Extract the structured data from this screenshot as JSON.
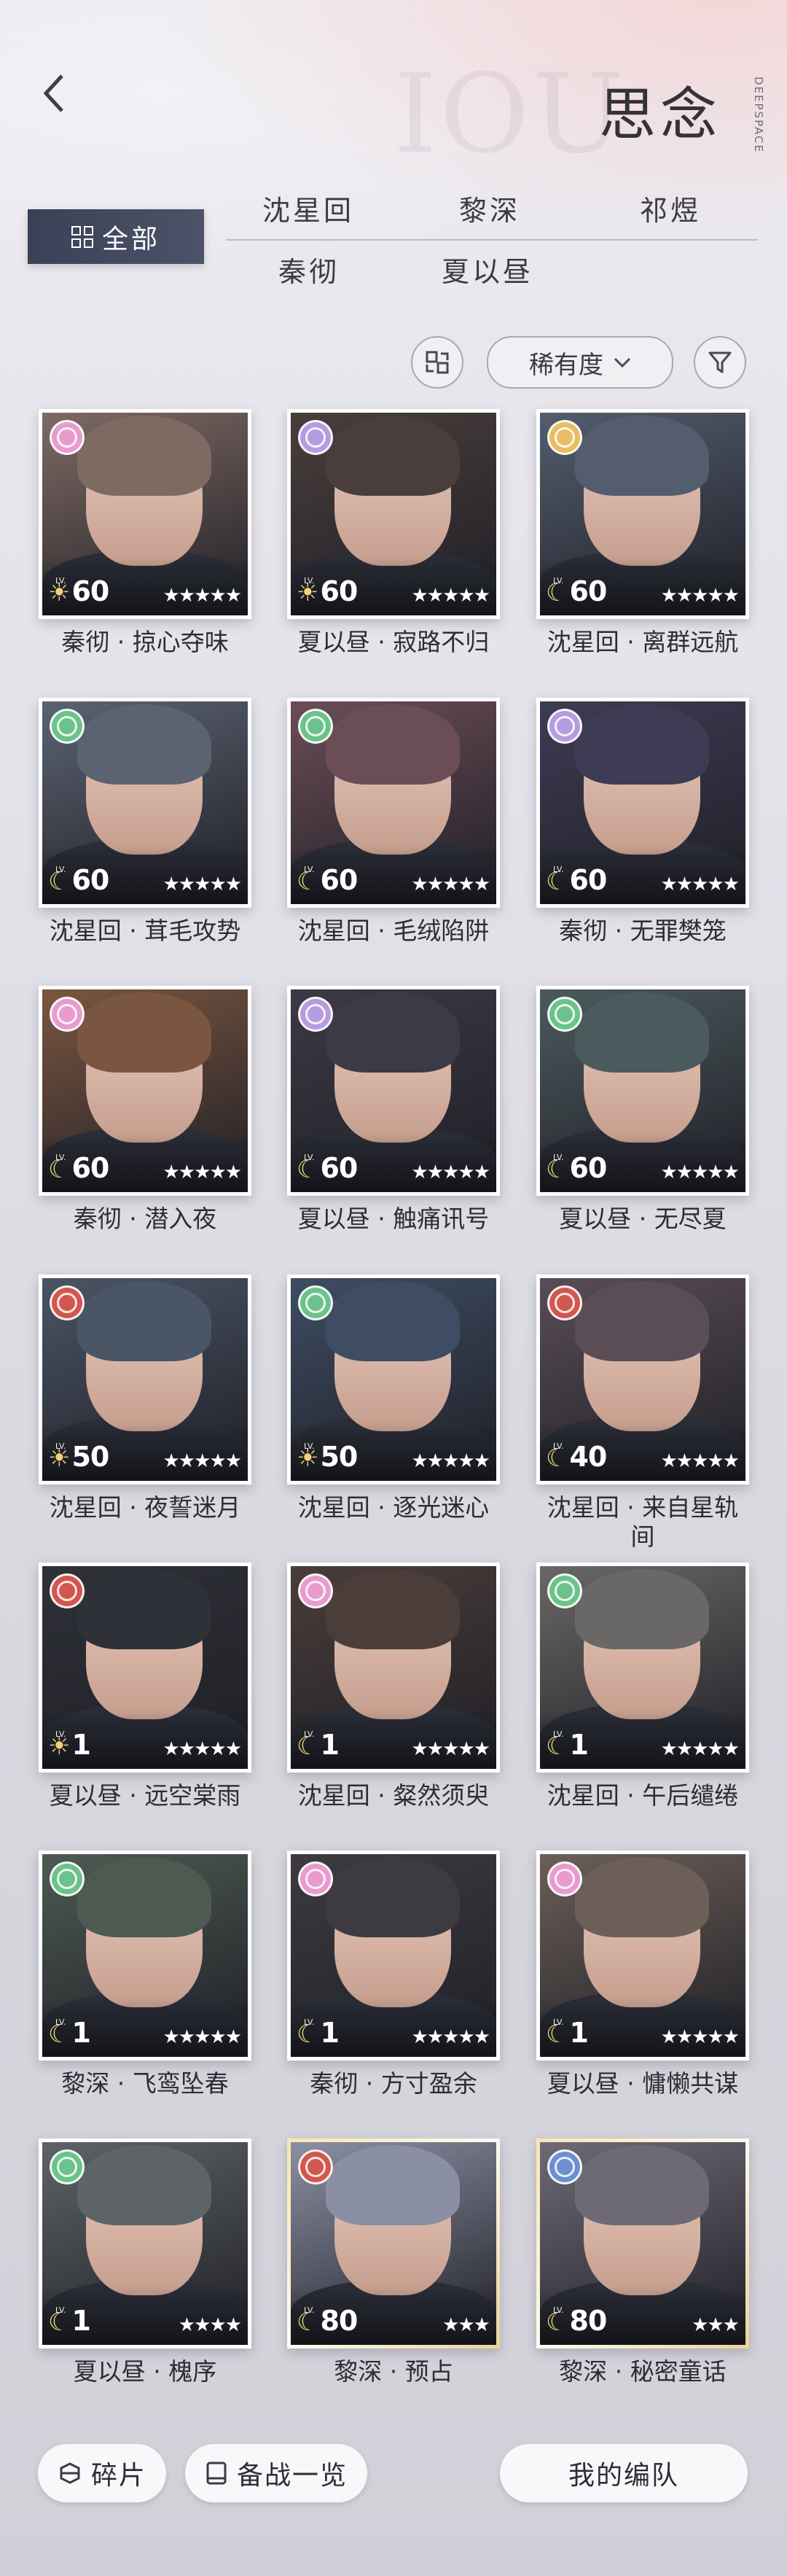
{
  "header": {
    "title": "思念",
    "watermark": "IOU",
    "vertical_text": "DEEPSPACE"
  },
  "tabs": {
    "all": "全部",
    "characters": [
      "沈星回",
      "黎深",
      "祁煜",
      "秦彻",
      "夏以昼"
    ]
  },
  "sort": {
    "label": "稀有度"
  },
  "cards": [
    {
      "name": "秦彻 · 掠心夺味",
      "level": "60",
      "lv_icon": "sun-icon",
      "stars": 5,
      "badge": "#e79ccd",
      "tone": "#7e6a63"
    },
    {
      "name": "夏以昼 · 寂路不归",
      "level": "60",
      "lv_icon": "sun-icon",
      "stars": 5,
      "badge": "#b69be0",
      "tone": "#4a3e3c"
    },
    {
      "name": "沈星回 · 离群远航",
      "level": "60",
      "lv_icon": "moon-icon",
      "stars": 5,
      "badge": "#e8bd63",
      "tone": "#535d6e"
    },
    {
      "name": "沈星回 · 茸毛攻势",
      "level": "60",
      "lv_icon": "moon-icon",
      "stars": 5,
      "badge": "#6bc38a",
      "tone": "#5b6371"
    },
    {
      "name": "沈星回 · 毛绒陷阱",
      "level": "60",
      "lv_icon": "moon-icon",
      "stars": 5,
      "badge": "#6bc38a",
      "tone": "#6b4d56"
    },
    {
      "name": "秦彻 · 无罪樊笼",
      "level": "60",
      "lv_icon": "moon-icon",
      "stars": 5,
      "badge": "#b69be0",
      "tone": "#3d3c54"
    },
    {
      "name": "秦彻 · 潜入夜",
      "level": "60",
      "lv_icon": "moon-icon",
      "stars": 5,
      "badge": "#e79ccd",
      "tone": "#7a5640"
    },
    {
      "name": "夏以昼 · 触痛讯号",
      "level": "60",
      "lv_icon": "moon-icon",
      "stars": 5,
      "badge": "#b69be0",
      "tone": "#3c3a45"
    },
    {
      "name": "夏以昼 · 无尽夏",
      "level": "60",
      "lv_icon": "moon-icon",
      "stars": 5,
      "badge": "#6bc38a",
      "tone": "#4b5a5d"
    },
    {
      "name": "沈星回 · 夜誓迷月",
      "level": "50",
      "lv_icon": "sun-icon",
      "stars": 5,
      "badge": "#d1574f",
      "tone": "#4a5565"
    },
    {
      "name": "沈星回 · 逐光迷心",
      "level": "50",
      "lv_icon": "sun-icon",
      "stars": 5,
      "badge": "#6bc38a",
      "tone": "#3e4d63"
    },
    {
      "name": "沈星回 · 来自星轨间",
      "level": "40",
      "lv_icon": "moon-icon",
      "stars": 5,
      "badge": "#d1574f",
      "tone": "#5a4d55"
    },
    {
      "name": "夏以昼 · 远空棠雨",
      "level": "1",
      "lv_icon": "sun-icon",
      "stars": 5,
      "badge": "#d1574f",
      "tone": "#2f3138"
    },
    {
      "name": "沈星回 · 粲然须臾",
      "level": "1",
      "lv_icon": "moon-icon",
      "stars": 5,
      "badge": "#e79ccd",
      "tone": "#4a3d3a"
    },
    {
      "name": "沈星回 · 午后缱绻",
      "level": "1",
      "lv_icon": "moon-icon",
      "stars": 5,
      "badge": "#6bc38a",
      "tone": "#6a6866"
    },
    {
      "name": "黎深 · 飞鸾坠春",
      "level": "1",
      "lv_icon": "moon-icon",
      "stars": 5,
      "badge": "#6bc38a",
      "tone": "#4d5a52"
    },
    {
      "name": "秦彻 · 方寸盈余",
      "level": "1",
      "lv_icon": "moon-icon",
      "stars": 5,
      "badge": "#e79ccd",
      "tone": "#3d3b40"
    },
    {
      "name": "夏以昼 · 慵懒共谋",
      "level": "1",
      "lv_icon": "moon-icon",
      "stars": 5,
      "badge": "#e79ccd",
      "tone": "#6b5f58"
    },
    {
      "name": "夏以昼 · 槐序",
      "level": "1",
      "lv_icon": "moon-icon",
      "stars": 4,
      "badge": "#6bc38a",
      "tone": "#5d6366"
    },
    {
      "name": "黎深 · 预占",
      "level": "80",
      "lv_icon": "moon-icon",
      "stars": 3,
      "badge": "#d1574f",
      "tone": "#8a8fa3"
    },
    {
      "name": "黎深 · 秘密童话",
      "level": "80",
      "lv_icon": "moon-icon",
      "stars": 3,
      "badge": "#6b8fd0",
      "tone": "#6e6a75"
    }
  ],
  "bottom": {
    "fragments": "碎片",
    "overview": "备战一览",
    "my_team": "我的编队"
  }
}
